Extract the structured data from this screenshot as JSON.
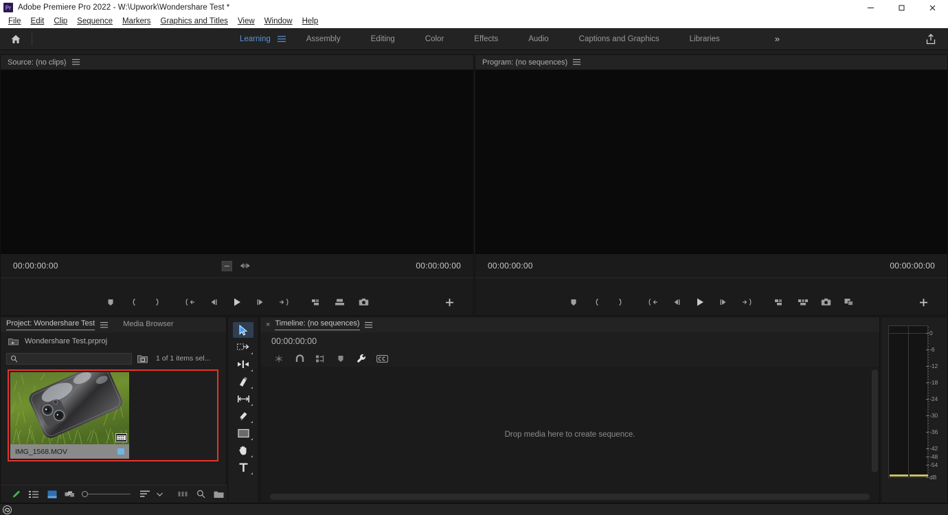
{
  "window": {
    "app_title": "Adobe Premiere Pro 2022 - W:\\Upwork\\Wondershare Test *",
    "logo_text": "Pr",
    "minimize": "—",
    "maximize": "❐",
    "close": "✕"
  },
  "menubar": {
    "items": [
      "File",
      "Edit",
      "Clip",
      "Sequence",
      "Markers",
      "Graphics and Titles",
      "View",
      "Window",
      "Help"
    ]
  },
  "workspace": {
    "home_icon": "home-icon",
    "tabs": [
      {
        "label": "Learning",
        "active": true
      },
      {
        "label": "Assembly",
        "active": false
      },
      {
        "label": "Editing",
        "active": false
      },
      {
        "label": "Color",
        "active": false
      },
      {
        "label": "Effects",
        "active": false
      },
      {
        "label": "Audio",
        "active": false
      },
      {
        "label": "Captions and Graphics",
        "active": false
      },
      {
        "label": "Libraries",
        "active": false
      }
    ],
    "overflow": "»",
    "export_icon": "share-export-icon"
  },
  "source_monitor": {
    "title": "Source: (no clips)",
    "menu_icon": "panel-menu-icon",
    "playhead_timecode": "00:00:00:00",
    "duration_timecode": "00:00:00:00",
    "transport": [
      "add-marker",
      "mark-in",
      "mark-out",
      "go-to-in",
      "step-back",
      "play-stop",
      "step-forward",
      "go-to-out",
      "insert",
      "overwrite",
      "export-frame"
    ],
    "button_editor": "+"
  },
  "program_monitor": {
    "title": "Program: (no sequences)",
    "menu_icon": "panel-menu-icon",
    "playhead_timecode": "00:00:00:00",
    "duration_timecode": "00:00:00:00",
    "transport": [
      "add-marker",
      "mark-in",
      "mark-out",
      "go-to-in",
      "step-back",
      "play-stop",
      "step-forward",
      "go-to-out",
      "lift",
      "extract",
      "export-frame",
      "comparison-view"
    ],
    "button_editor": "+"
  },
  "project_panel": {
    "tab_label": "Project: Wondershare Test",
    "menu_icon": "panel-menu-icon",
    "media_browser_tab": "Media Browser",
    "project_file": "Wondershare Test.prproj",
    "search_placeholder": "",
    "search_value": "",
    "new_bin_icon": "new-bin-icon",
    "items_status": "1 of 1 items sel...",
    "clip": {
      "name": "IMG_1568.MOV",
      "badge": "film-strip-icon",
      "label_color": "#6fb6e8",
      "selected": true,
      "selection_color": "#e8332a"
    },
    "toolbar": [
      "freeform-pen-tool",
      "list-view",
      "icon-view",
      "freeform-view",
      "zoom-slider",
      "sort-icon",
      "sort-chevron",
      "automate-to-sequence",
      "find",
      "new-bin"
    ]
  },
  "tools_panel": {
    "tools": [
      {
        "name": "selection-tool",
        "active": true
      },
      {
        "name": "track-select-forward-tool",
        "active": false
      },
      {
        "name": "ripple-edit-tool",
        "active": false
      },
      {
        "name": "razor-tool",
        "active": false
      },
      {
        "name": "slip-tool",
        "active": false
      },
      {
        "name": "pen-tool",
        "active": false
      },
      {
        "name": "rectangle-tool",
        "active": false
      },
      {
        "name": "hand-tool",
        "active": false
      },
      {
        "name": "type-tool",
        "active": false
      }
    ]
  },
  "timeline_panel": {
    "close_icon": "×",
    "tab_label": "Timeline: (no sequences)",
    "menu_icon": "panel-menu-icon",
    "timecode": "00:00:00:00",
    "toolbar": [
      "insert-overwrite-indicator",
      "snap-magnet",
      "linked-selection",
      "add-marker",
      "timeline-settings-wrench",
      "closed-captions"
    ],
    "empty_message": "Drop media here to create sequence."
  },
  "audio_meters": {
    "unit_label": "dB",
    "ticks": [
      "0",
      "-6",
      "-12",
      "-18",
      "-24",
      "-30",
      "-36",
      "-42",
      "-48",
      "-54"
    ],
    "channels": 2,
    "level_color": "#c9c264"
  },
  "statusbar": {
    "cc_icon": "creative-cloud-icon"
  }
}
